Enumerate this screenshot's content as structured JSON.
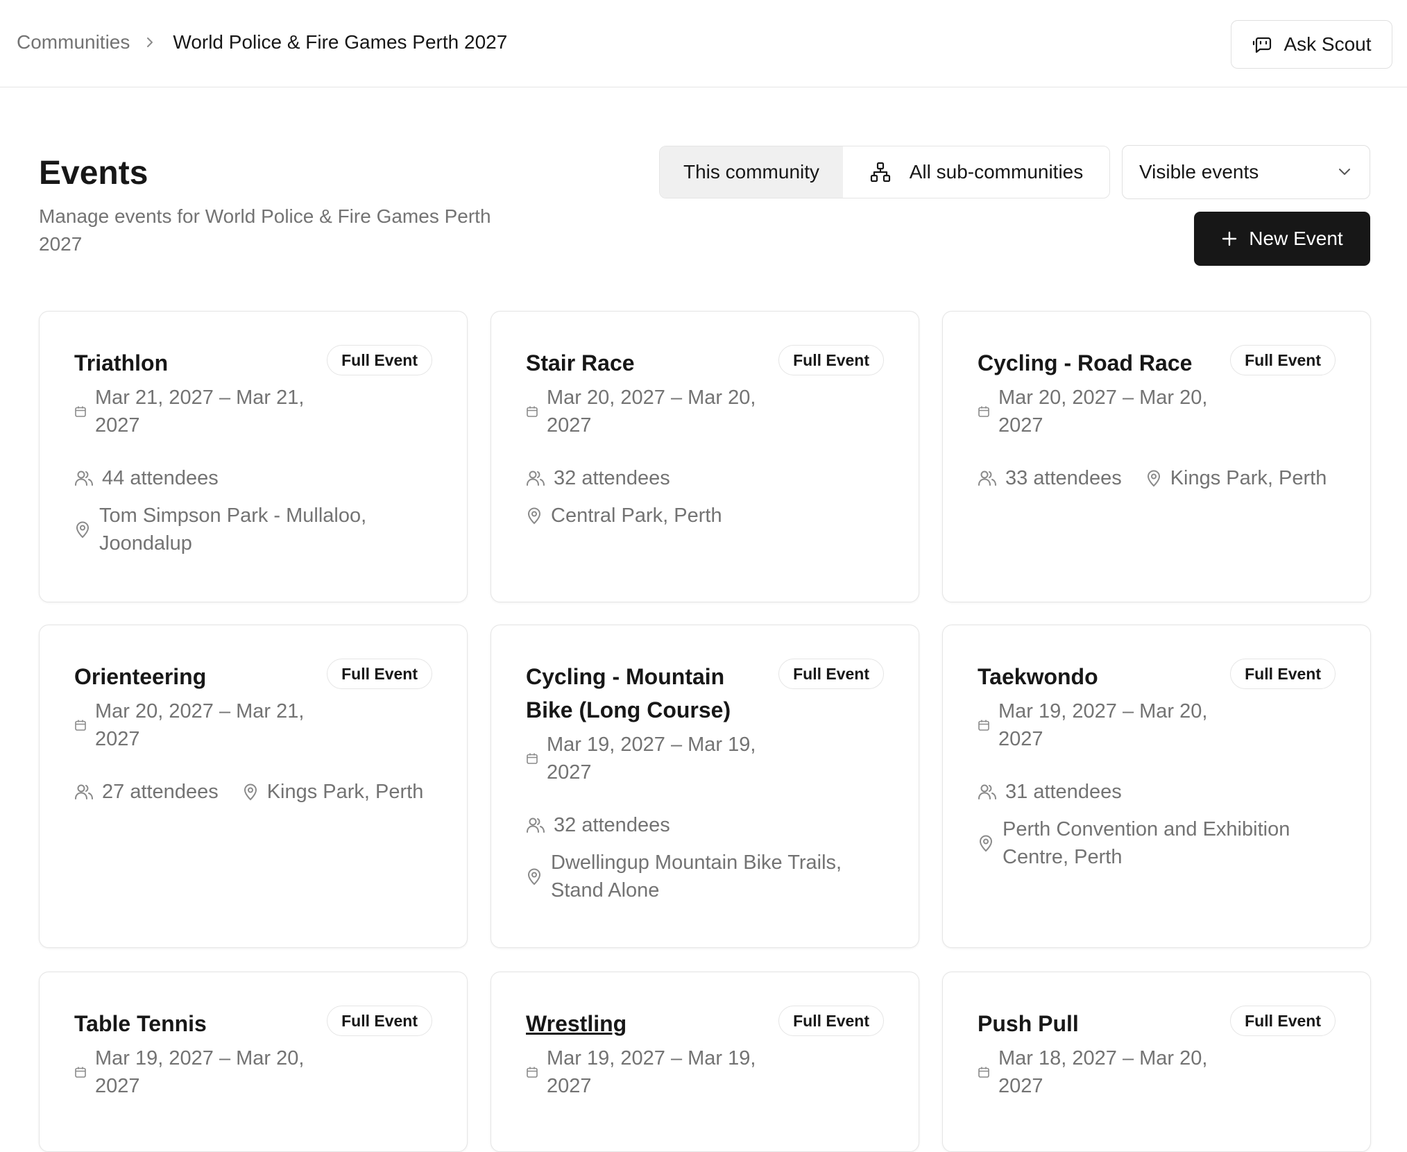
{
  "breadcrumb": {
    "root": "Communities",
    "current": "World Police & Fire Games Perth 2027"
  },
  "header": {
    "ask_label": "Ask Scout"
  },
  "page": {
    "title": "Events",
    "subtitle": "Manage events for World Police & Fire Games Perth 2027"
  },
  "scope_toggle": {
    "this_community": "This community",
    "all_sub": "All sub-communities",
    "selected": "This community"
  },
  "visibility_select": {
    "value": "Visible events"
  },
  "new_event_label": "New Event",
  "events": [
    {
      "title": "Triathlon",
      "badge": "Full Event",
      "date": "Mar 21, 2027 – Mar 21, 2027",
      "attendees": "44 attendees",
      "location": "Tom Simpson Park - Mullaloo, Joondalup"
    },
    {
      "title": "Stair Race",
      "badge": "Full Event",
      "date": "Mar 20, 2027 – Mar 20, 2027",
      "attendees": "32 attendees",
      "location": "Central Park, Perth"
    },
    {
      "title": "Cycling - Road Race",
      "badge": "Full Event",
      "date": "Mar 20, 2027 – Mar 20, 2027",
      "attendees": "33 attendees",
      "location": "Kings Park, Perth"
    },
    {
      "title": "Orienteering",
      "badge": "Full Event",
      "date": "Mar 20, 2027 – Mar 21, 2027",
      "attendees": "27 attendees",
      "location": "Kings Park, Perth"
    },
    {
      "title": "Cycling - Mountain Bike (Long Course)",
      "badge": "Full Event",
      "date": "Mar 19, 2027 – Mar 19, 2027",
      "attendees": "32 attendees",
      "location": "Dwellingup Mountain Bike Trails, Stand Alone"
    },
    {
      "title": "Taekwondo",
      "badge": "Full Event",
      "date": "Mar 19, 2027 – Mar 20, 2027",
      "attendees": "31 attendees",
      "location": "Perth Convention and Exhibition Centre, Perth"
    },
    {
      "title": "Table Tennis",
      "badge": "Full Event",
      "date": "Mar 19, 2027 – Mar 20, 2027",
      "attendees": "",
      "location": ""
    },
    {
      "title": "Wrestling",
      "badge": "Full Event",
      "date": "Mar 19, 2027 – Mar 19, 2027",
      "attendees": "",
      "location": ""
    },
    {
      "title": "Push Pull",
      "badge": "Full Event",
      "date": "Mar 18, 2027 – Mar 20, 2027",
      "attendees": "",
      "location": ""
    }
  ]
}
